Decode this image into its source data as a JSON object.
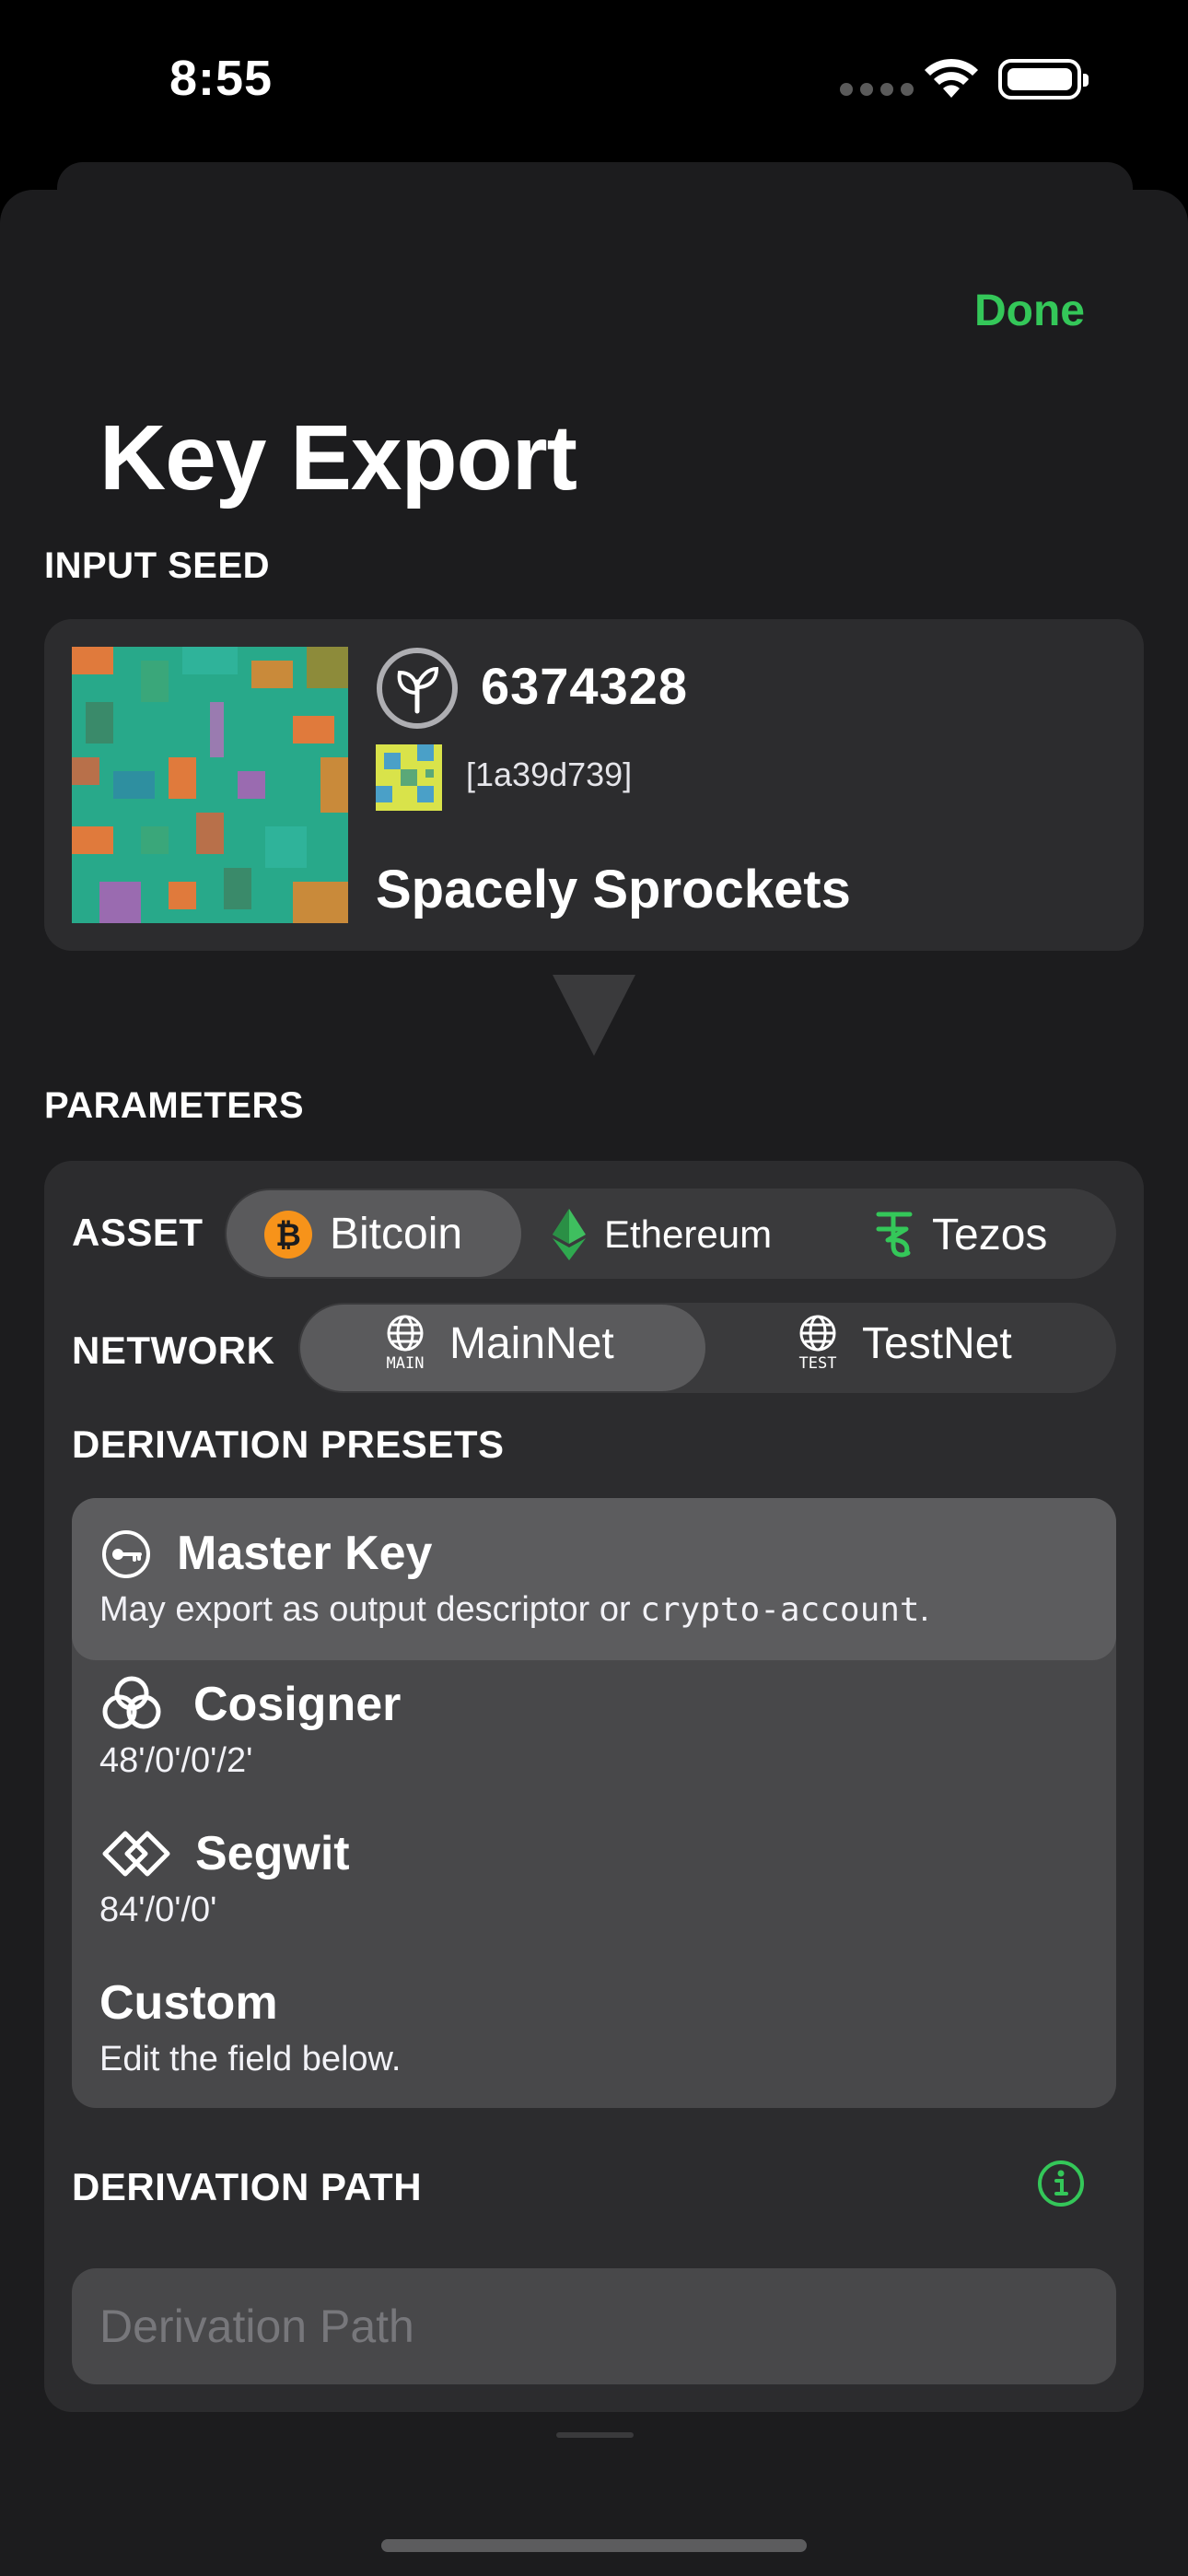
{
  "status_bar": {
    "time": "8:55"
  },
  "nav": {
    "done_label": "Done",
    "title": "Key Export"
  },
  "input_seed": {
    "section_label": "INPUT SEED",
    "seed_number": "6374328",
    "fingerprint": "[1a39d739]",
    "name": "Spacely Sprockets",
    "icon": "seed-leaf-icon"
  },
  "parameters": {
    "section_label": "PARAMETERS",
    "asset": {
      "label": "ASSET",
      "options": [
        {
          "label": "Bitcoin",
          "icon": "bitcoin-icon",
          "color": "#f7931a",
          "selected": true
        },
        {
          "label": "Ethereum",
          "icon": "ethereum-icon",
          "color": "#2fa84f",
          "selected": false
        },
        {
          "label": "Tezos",
          "icon": "tezos-icon",
          "color": "#34c759",
          "selected": false
        }
      ]
    },
    "network": {
      "label": "NETWORK",
      "options": [
        {
          "label": "MainNet",
          "badge": "MAIN",
          "icon": "globe-icon",
          "selected": true
        },
        {
          "label": "TestNet",
          "badge": "TEST",
          "icon": "globe-icon",
          "selected": false
        }
      ]
    },
    "derivation_presets": {
      "label": "DERIVATION PRESETS",
      "items": [
        {
          "title": "Master Key",
          "subtitle_prefix": "May export as output descriptor or ",
          "subtitle_code": "crypto-account",
          "subtitle_suffix": ".",
          "icon": "key-icon",
          "selected": true
        },
        {
          "title": "Cosigner",
          "subtitle": "48'/0'/0'/2'",
          "icon": "cosigner-rings-icon",
          "selected": false
        },
        {
          "title": "Segwit",
          "subtitle": "84'/0'/0'",
          "icon": "segwit-diamond-icon",
          "selected": false
        },
        {
          "title": "Custom",
          "subtitle": "Edit the field below.",
          "selected": false
        }
      ]
    },
    "derivation_path": {
      "label": "DERIVATION PATH",
      "placeholder": "Derivation Path",
      "value": ""
    }
  },
  "colors": {
    "accent": "#34c759",
    "sheet_bg": "#1c1c1e",
    "card_bg": "#2c2c2e",
    "bitcoin": "#f7931a"
  }
}
